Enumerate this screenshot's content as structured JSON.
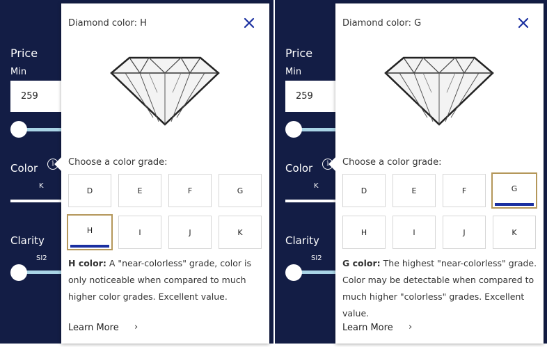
{
  "colors": {
    "navy": "#131d45",
    "accent_blue": "#1a2fa0",
    "gold": "#b4975a",
    "track": "#a9d4e6"
  },
  "left": {
    "filters": {
      "price_label": "Price",
      "min_label": "Min",
      "min_value": "259",
      "color_label": "Color",
      "color_range_value": "K",
      "clarity_label": "Clarity",
      "clarity_range_value": "SI2"
    },
    "popup": {
      "title": "Diamond color: H",
      "choose_label": "Choose a color grade:",
      "grades": [
        "D",
        "E",
        "F",
        "G",
        "H",
        "I",
        "J",
        "K"
      ],
      "selected": "H",
      "desc_label": "H color:",
      "desc_text": " A \"near-colorless\" grade, color is only noticeable when compared to much higher color grades. Excellent value.",
      "learn_more": "Learn More"
    }
  },
  "right": {
    "filters": {
      "price_label": "Price",
      "min_label": "Min",
      "min_value": "259",
      "color_label": "Color",
      "color_range_value": "K",
      "clarity_label": "Clarity",
      "clarity_range_value": "SI2"
    },
    "popup": {
      "title": "Diamond color: G",
      "choose_label": "Choose a color grade:",
      "grades": [
        "D",
        "E",
        "F",
        "G",
        "H",
        "I",
        "J",
        "K"
      ],
      "selected": "G",
      "desc_label": "G color:",
      "desc_text": " The highest \"near-colorless\" grade. Color may be detectable when compared to much higher \"colorless\" grades. Excellent value.",
      "learn_more": "Learn More"
    }
  }
}
